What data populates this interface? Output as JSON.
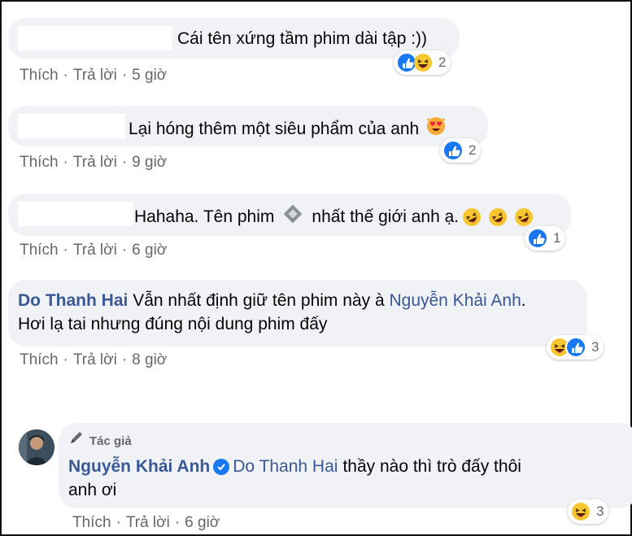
{
  "comments": [
    {
      "text": "Cái tên xứng tầm phim dài tập :))",
      "actions": {
        "like": "Thích",
        "reply": "Trả lời",
        "time": "5 giờ"
      },
      "reactions": {
        "icons": [
          "like-icon",
          "haha-icon"
        ],
        "count": "2"
      }
    },
    {
      "text": "Lại hóng thêm một siêu phẩm của anh",
      "actions": {
        "like": "Thích",
        "reply": "Trả lời",
        "time": "9 giờ"
      },
      "reactions": {
        "icons": [
          "like-icon"
        ],
        "count": "2"
      }
    },
    {
      "text_before": "Hahaha. Tên phim",
      "text_after": "nhất thế giới anh ạ.",
      "actions": {
        "like": "Thích",
        "reply": "Trả lời",
        "time": "6 giờ"
      },
      "reactions": {
        "icons": [
          "like-icon"
        ],
        "count": "1"
      }
    },
    {
      "author": "Do Thanh Hai",
      "text_before": "Vẫn nhất định giữ tên phim này à",
      "mention": "Nguyễn Khải Anh",
      "text_after": ".",
      "text_line2": "Hơi lạ tai nhưng đúng nội dung phim đấy",
      "actions": {
        "like": "Thích",
        "reply": "Trả lời",
        "time": "8 giờ"
      },
      "reactions": {
        "icons": [
          "haha-icon",
          "like-icon"
        ],
        "count": "3"
      }
    }
  ],
  "reply": {
    "badge": "Tác giả",
    "author": "Nguyễn Khải Anh",
    "mention": "Do Thanh Hai",
    "text": "thầy nào thì trò đấy thôi",
    "text_line2": "anh ơi",
    "actions": {
      "like": "Thích",
      "reply": "Trả lời",
      "time": "6 giờ"
    },
    "reactions": {
      "icons": [
        "haha-icon"
      ],
      "count": "3"
    }
  },
  "colors": {
    "bubble": "#f0f2f5",
    "link": "#385898",
    "meta": "#65676b",
    "like": "#1877f2",
    "haha": "#f7c631"
  }
}
